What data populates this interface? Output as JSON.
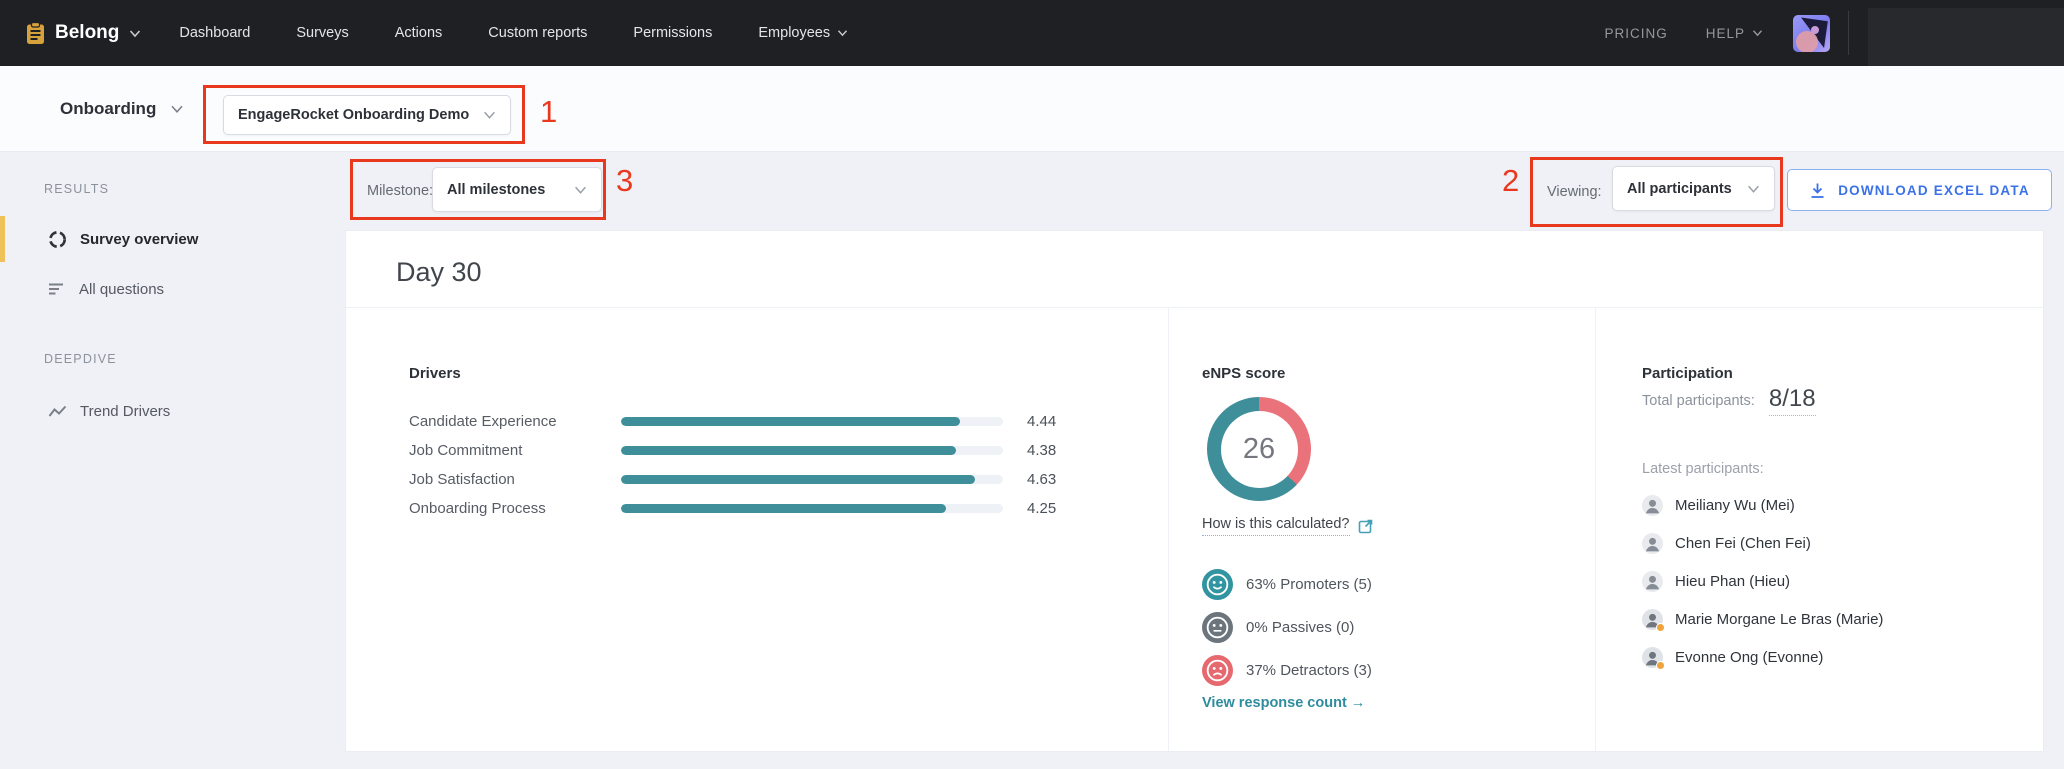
{
  "nav": {
    "brand": {
      "label": "Belong"
    },
    "items": [
      {
        "label": "Dashboard"
      },
      {
        "label": "Surveys"
      },
      {
        "label": "Actions"
      },
      {
        "label": "Custom reports"
      },
      {
        "label": "Permissions"
      },
      {
        "label": "Employees"
      }
    ],
    "right": {
      "pricing": "PRICING",
      "help": "HELP"
    }
  },
  "subheader": {
    "program_label": "Onboarding",
    "survey_select_value": "EngageRocket Onboarding Demo"
  },
  "annotations": {
    "one": "1",
    "two": "2",
    "three": "3"
  },
  "sidebar": {
    "sections": [
      {
        "title": "RESULTS",
        "items": [
          {
            "label": "Survey overview"
          },
          {
            "label": "All questions"
          }
        ]
      },
      {
        "title": "DEEPDIVE",
        "items": [
          {
            "label": "Trend Drivers"
          }
        ]
      }
    ]
  },
  "toolbar": {
    "milestone_label": "Milestone:",
    "milestone_value": "All milestones",
    "viewing_label": "Viewing:",
    "viewing_value": "All participants",
    "download_label": "DOWNLOAD EXCEL DATA"
  },
  "main": {
    "title": "Day 30",
    "drivers": {
      "heading": "Drivers",
      "max_score": 5,
      "rows": [
        {
          "label": "Candidate Experience",
          "value": "4.44"
        },
        {
          "label": "Job Commitment",
          "value": "4.38"
        },
        {
          "label": "Job Satisfaction",
          "value": "4.63"
        },
        {
          "label": "Onboarding Process",
          "value": "4.25"
        }
      ]
    },
    "enps": {
      "heading": "eNPS score",
      "score": "26",
      "calc_link": "How is this calculated?",
      "breakdown": [
        {
          "type": "promoter",
          "label": "63% Promoters (5)",
          "pct": 63
        },
        {
          "type": "passive",
          "label": "0% Passives (0)",
          "pct": 0
        },
        {
          "type": "detractor",
          "label": "37% Detractors (3)",
          "pct": 37
        }
      ],
      "response_link": "View response count →"
    },
    "participation": {
      "heading": "Participation",
      "total_label": "Total participants:",
      "total_value": "8/18",
      "latest_label": "Latest participants:",
      "participants": [
        {
          "name": "Meiliany Wu (Mei)",
          "badge": false
        },
        {
          "name": "Chen Fei (Chen Fei)",
          "badge": false
        },
        {
          "name": "Hieu Phan (Hieu)",
          "badge": false
        },
        {
          "name": "Marie Morgane Le Bras (Marie)",
          "badge": true
        },
        {
          "name": "Evonne Ong (Evonne)",
          "badge": true
        }
      ]
    }
  },
  "chart_data": [
    {
      "type": "bar",
      "orientation": "horizontal",
      "title": "Drivers",
      "categories": [
        "Candidate Experience",
        "Job Commitment",
        "Job Satisfaction",
        "Onboarding Process"
      ],
      "values": [
        4.44,
        4.38,
        4.63,
        4.25
      ],
      "xlim": [
        0,
        5
      ]
    },
    {
      "type": "pie",
      "title": "eNPS score",
      "labels": [
        "Promoters",
        "Passives",
        "Detractors"
      ],
      "values": [
        63,
        0,
        37
      ],
      "counts": [
        5,
        0,
        3
      ],
      "center_label": "26"
    }
  ],
  "colors": {
    "teal": "#3f8f9b",
    "salmon": "#ea737b",
    "passive": "#6c747c",
    "detractor": "#e5696f",
    "red": "#e8391f",
    "blue": "#3b72e8",
    "gold": "#d7a13c",
    "accent": "#eec258",
    "tealink": "#2e8c9e"
  }
}
